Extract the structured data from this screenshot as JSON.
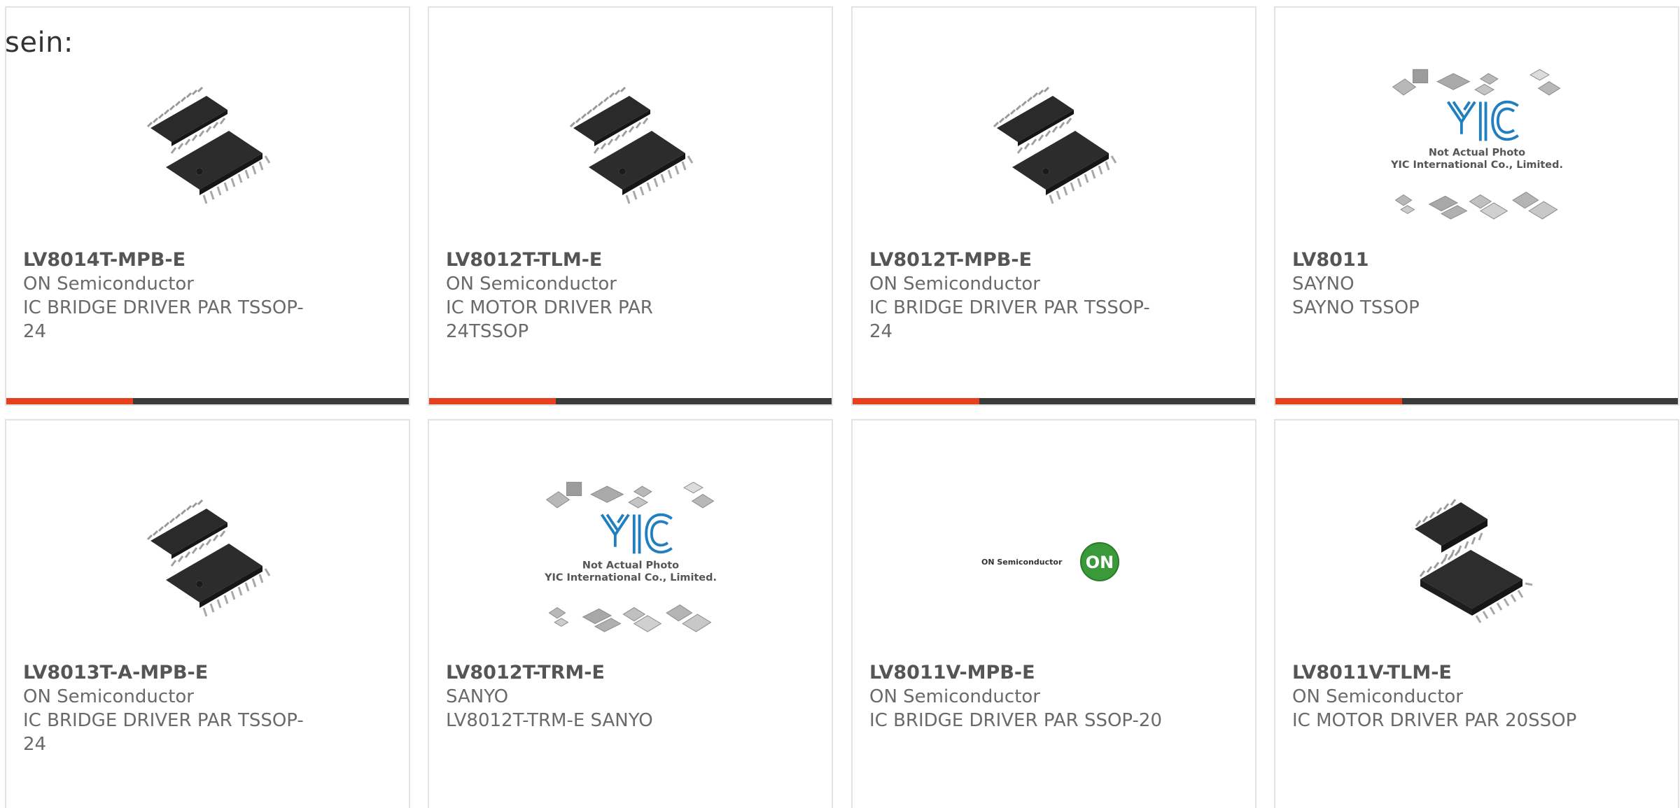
{
  "intro_text": "sein:",
  "colors": {
    "accent": "#e8401c",
    "bar_dark": "#3b3b3b",
    "card_border": "#e3e3e3",
    "text": "#6a6a6a",
    "yic_blue": "#1f7fc0",
    "on_green": "#3a9a3a"
  },
  "placeholder": {
    "line1": "Not Actual Photo",
    "line2": "YIC International Co., Limited."
  },
  "on_logo": {
    "wordmark": "ON Semiconductor",
    "badge": "ON"
  },
  "cards": [
    {
      "part": "LV8014T-MPB-E",
      "maker": "ON Semiconductor",
      "desc": "IC BRIDGE DRIVER PAR TSSOP-24",
      "image": "tssop-chip-icon"
    },
    {
      "part": "LV8012T-TLM-E",
      "maker": "ON Semiconductor",
      "desc": "IC MOTOR DRIVER PAR 24TSSOP",
      "image": "tssop-chip-icon"
    },
    {
      "part": "LV8012T-MPB-E",
      "maker": "ON Semiconductor",
      "desc": "IC BRIDGE DRIVER PAR TSSOP-24",
      "image": "tssop-chip-icon"
    },
    {
      "part": "LV8011",
      "maker": "SAYNO",
      "desc": "SAYNO TSSOP",
      "image": "yic-placeholder-icon"
    },
    {
      "part": "LV8013T-A-MPB-E",
      "maker": "ON Semiconductor",
      "desc": "IC BRIDGE DRIVER PAR TSSOP-24",
      "image": "tssop-chip-icon"
    },
    {
      "part": "LV8012T-TRM-E",
      "maker": "SANYO",
      "desc": "LV8012T-TRM-E SANYO",
      "image": "yic-placeholder-icon"
    },
    {
      "part": "LV8011V-MPB-E",
      "maker": "ON Semiconductor",
      "desc": "IC BRIDGE DRIVER PAR SSOP-20",
      "image": "on-semi-logo-icon"
    },
    {
      "part": "LV8011V-TLM-E",
      "maker": "ON Semiconductor",
      "desc": "IC MOTOR DRIVER PAR 20SSOP",
      "image": "ssop-chip-icon"
    }
  ]
}
